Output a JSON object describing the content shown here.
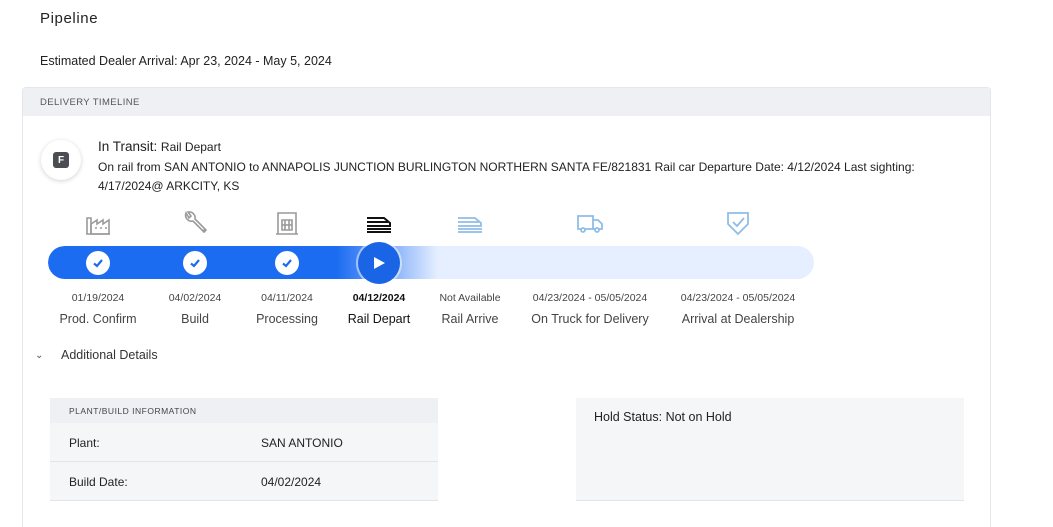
{
  "page": {
    "title": "Pipeline",
    "estimated_arrival": "Estimated Dealer Arrival: Apr 23, 2024 - May 5, 2024"
  },
  "timeline": {
    "header": "DELIVERY TIMELINE",
    "badge_letter": "F",
    "status_label": "In Transit:",
    "status_step": "Rail Depart",
    "description": "On rail from SAN ANTONIO to ANNAPOLIS JUNCTION BURLINGTON NORTHERN SANTA FE/821831 Rail car Departure Date: 4/12/2024 Last sighting: 4/17/2024@ ARKCITY, KS",
    "progress_steps_completed": 4,
    "progress_steps_total": 7,
    "steps": [
      {
        "date": "01/19/2024",
        "label": "Prod. Confirm",
        "icon": "factory-icon",
        "state": "complete"
      },
      {
        "date": "04/02/2024",
        "label": "Build",
        "icon": "wrench-icon",
        "state": "complete"
      },
      {
        "date": "04/11/2024",
        "label": "Processing",
        "icon": "processing-icon",
        "state": "complete"
      },
      {
        "date": "04/12/2024",
        "label": "Rail Depart",
        "icon": "rail-icon",
        "state": "current"
      },
      {
        "date": "Not Available",
        "label": "Rail Arrive",
        "icon": "rail-icon",
        "state": "upcoming"
      },
      {
        "date": "04/23/2024 - 05/05/2024",
        "label": "On Truck for Delivery",
        "icon": "truck-icon",
        "state": "upcoming"
      },
      {
        "date": "04/23/2024 - 05/05/2024",
        "label": "Arrival at Dealership",
        "icon": "shield-check-icon",
        "state": "upcoming"
      }
    ],
    "colors": {
      "progress": "#1c6cf2",
      "track": "#e6efff",
      "completed_icon": "#9a9a9a",
      "upcoming_icon": "#8fbde6",
      "current_icon": "#111111"
    }
  },
  "details": {
    "toggle_label": "Additional Details",
    "plant": {
      "header": "PLANT/BUILD INFORMATION",
      "rows": [
        {
          "key": "Plant:",
          "value": "SAN ANTONIO"
        },
        {
          "key": "Build Date:",
          "value": "04/02/2024"
        }
      ]
    },
    "hold_status": "Hold Status: Not on Hold"
  }
}
